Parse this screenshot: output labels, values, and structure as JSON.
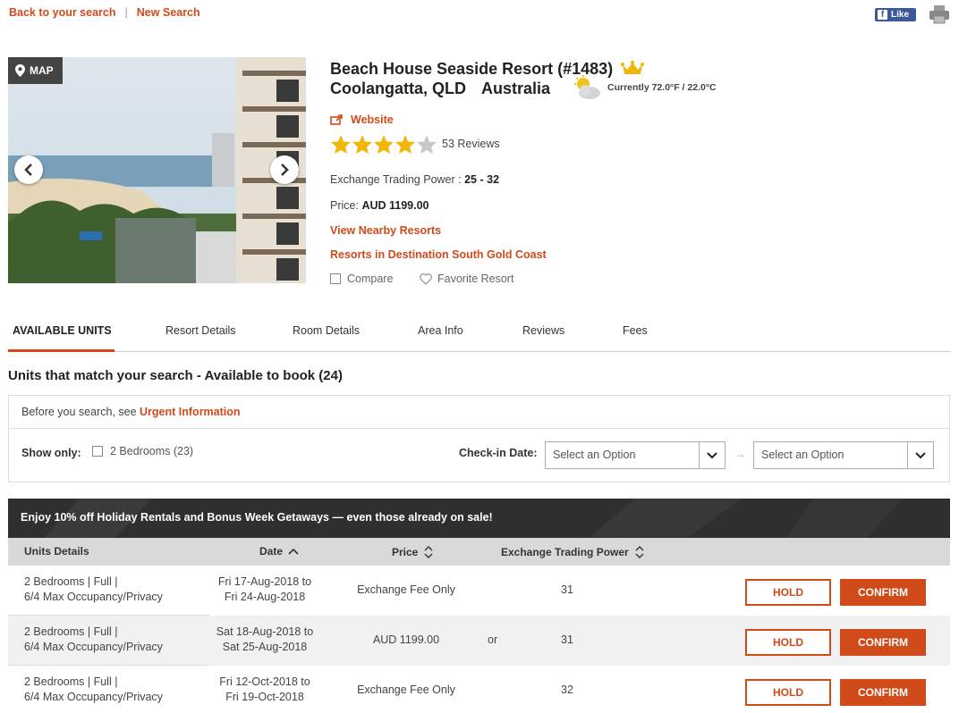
{
  "topnav": {
    "back": "Back to your search",
    "sep": "|",
    "new_search": "New Search"
  },
  "social": {
    "like": "Like",
    "f": "f"
  },
  "photo": {
    "map_label": "MAP"
  },
  "resort": {
    "title": "Beach House Seaside Resort (#1483)",
    "city": "Coolangatta, QLD",
    "country": "Australia",
    "weather": "Currently 72.0°F / 22.0°C",
    "website": "Website",
    "rating": 4,
    "reviews": "53 Reviews",
    "etp_label": "Exchange Trading Power :",
    "etp_value": "25 - 32",
    "price_label": "Price:",
    "price_value": "AUD 1199.00",
    "view_nearby": "View Nearby Resorts",
    "destination": "Resorts in Destination South Gold Coast",
    "compare": "Compare",
    "favorite": "Favorite Resort"
  },
  "tabs": [
    {
      "label": "AVAILABLE UNITS"
    },
    {
      "label": "Resort Details"
    },
    {
      "label": "Room Details"
    },
    {
      "label": "Area Info"
    },
    {
      "label": "Reviews"
    },
    {
      "label": "Fees"
    }
  ],
  "available": {
    "heading": "Units that match your search - Available to book (24)"
  },
  "filters": {
    "before_text": "Before you search, see",
    "urgent_link": "Urgent Information",
    "show_only": "Show only:",
    "bedrooms_option": "2 Bedrooms (23)",
    "checkin_label": "Check-in Date:",
    "select_placeholder_1": "Select an Option",
    "select_placeholder_2": "Select an Option"
  },
  "promo": {
    "text": "Enjoy 10% off Holiday Rentals and Bonus Week Getaways — even those already on sale!"
  },
  "table": {
    "headers": {
      "units": "Units Details",
      "date": "Date",
      "price": "Price",
      "etp": "Exchange Trading Power"
    },
    "rows": [
      {
        "unit1": "2 Bedrooms | Full |",
        "unit2": "6/4 Max Occupancy/Privacy",
        "date1": "Fri 17-Aug-2018 to",
        "date2": "Fri 24-Aug-2018",
        "price": "Exchange Fee Only",
        "or": "",
        "etp": "31",
        "hold": "HOLD",
        "confirm": "CONFIRM"
      },
      {
        "unit1": "2 Bedrooms | Full |",
        "unit2": "6/4 Max Occupancy/Privacy",
        "date1": "Sat 18-Aug-2018 to",
        "date2": "Sat 25-Aug-2018",
        "price": "AUD 1199.00",
        "or": "or",
        "etp": "31",
        "hold": "HOLD",
        "confirm": "CONFIRM"
      },
      {
        "unit1": "2 Bedrooms | Full |",
        "unit2": "6/4 Max Occupancy/Privacy",
        "date1": "Fri 12-Oct-2018 to",
        "date2": "Fri 19-Oct-2018",
        "price": "Exchange Fee Only",
        "or": "",
        "etp": "32",
        "hold": "HOLD",
        "confirm": "CONFIRM"
      }
    ]
  },
  "colors": {
    "accent": "#d04a1a",
    "banner": "#2f2f2f",
    "header_bg": "#d9d9d9"
  }
}
